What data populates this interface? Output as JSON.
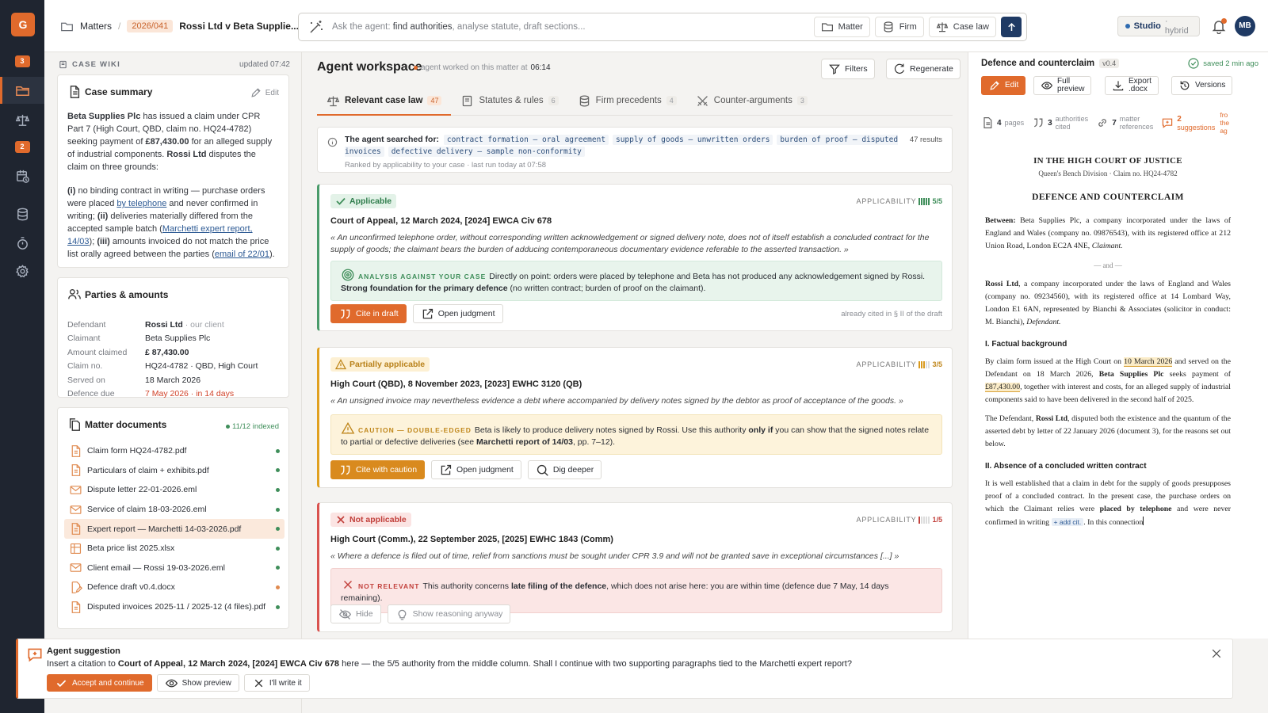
{
  "app": {
    "logo": "G",
    "avatar": "MB"
  },
  "rail": {
    "items": [
      {
        "name": "rail-inbox",
        "icon": "inbox-icon",
        "badge": "3"
      },
      {
        "name": "rail-matters",
        "icon": "folder-icon",
        "active": true
      },
      {
        "name": "rail-caselaw",
        "icon": "scales-icon"
      },
      {
        "name": "rail-tasks",
        "icon": "tasks-icon",
        "badge": "2"
      },
      {
        "name": "rail-calendar",
        "icon": "calendar-icon"
      },
      {
        "name": "rail-database",
        "icon": "database-icon"
      },
      {
        "name": "rail-timer",
        "icon": "timer-icon"
      },
      {
        "name": "rail-settings",
        "icon": "gear-icon"
      }
    ]
  },
  "breadcrumb": {
    "root": "Matters",
    "code": "2026/041",
    "title": "Rossi Ltd v Beta Supplie..."
  },
  "agent_bar": {
    "prefix": "Ask the agent: ",
    "highlight": "find authorities",
    "suffix": ", analyse statute, draft sections...",
    "scopes": [
      "Matter",
      "Firm",
      "Case law"
    ]
  },
  "studio": {
    "label": "Studio",
    "mode": "· hybrid"
  },
  "wiki": {
    "header": "CASE WIKI",
    "updated": "updated 07:42",
    "summary": {
      "title": "Case summary",
      "edit": "Edit",
      "p1": {
        "a": "Beta Supplies Plc",
        "b": " has issued a claim under CPR Part 7 (High Court, QBD, claim no. HQ24-4782) seeking payment of ",
        "c": "£87,430.00",
        "d": " for an alleged supply of industrial components. ",
        "e": "Rossi Ltd",
        "f": " disputes the claim on three grounds:"
      },
      "p2": {
        "a": "(i)",
        "b": " no binding contract in writing — purchase orders were placed ",
        "c": "by telephone",
        "d": " and never confirmed in writing; ",
        "e": "(ii)",
        "f": " deliveries materially differed from the accepted sample batch (",
        "g": "Marchetti expert report, 14/03",
        "h": "); ",
        "i": "(iii)",
        "j": " amounts invoiced do not match the price list orally agreed between the parties (",
        "k": "email of 22/01",
        "l": ")."
      }
    },
    "parties": {
      "title": "Parties & amounts",
      "rows": [
        {
          "k": "Defendant",
          "v": "Rossi Ltd",
          "sub": "· our client",
          "style": "b"
        },
        {
          "k": "Claimant",
          "v": "Beta Supplies Plc",
          "style": ""
        },
        {
          "k": "Amount claimed",
          "v": "£ 87,430.00",
          "style": "b"
        },
        {
          "k": "Claim no.",
          "v": "HQ24-4782 · QBD, High Court",
          "style": ""
        },
        {
          "k": "Served on",
          "v": "18 March 2026",
          "style": ""
        },
        {
          "k": "Defence due",
          "v": "7 May 2026 · in 14 days",
          "style": "red"
        }
      ]
    },
    "documents": {
      "title": "Matter documents",
      "indexed": "11/12 indexed",
      "items": [
        {
          "name": "Claim form HQ24-4782.pdf",
          "icon": "pdf-icon",
          "status": "ok"
        },
        {
          "name": "Particulars of claim + exhibits.pdf",
          "icon": "pdf-icon",
          "status": "ok"
        },
        {
          "name": "Dispute letter 22-01-2026.eml",
          "icon": "mail-icon",
          "status": "ok"
        },
        {
          "name": "Service of claim 18-03-2026.eml",
          "icon": "mail-icon",
          "status": "ok"
        },
        {
          "name": "Expert report — Marchetti 14-03-2026.pdf",
          "icon": "pdf-icon",
          "status": "ok",
          "selected": true
        },
        {
          "name": "Beta price list 2025.xlsx",
          "icon": "spreadsheet-icon",
          "status": "ok"
        },
        {
          "name": "Client email — Rossi 19-03-2026.eml",
          "icon": "mail-icon",
          "status": "ok"
        },
        {
          "name": "Defence draft v0.4.docx",
          "icon": "draft-icon",
          "status": "pending"
        },
        {
          "name": "Disputed invoices 2025-11 / 2025-12 (4 files).pdf",
          "icon": "pdf-icon",
          "status": "ok"
        }
      ]
    }
  },
  "workspace": {
    "title": "Agent workspace",
    "meta": "agent worked on this matter at",
    "meta_time": "06:14",
    "filters": "Filters",
    "regenerate": "Regenerate",
    "tabs": [
      {
        "label": "Relevant case law",
        "count": "47",
        "icon": "scales-icon",
        "active": true
      },
      {
        "label": "Statutes & rules",
        "count": "6",
        "icon": "book-icon"
      },
      {
        "label": "Firm precedents",
        "count": "4",
        "icon": "database-icon"
      },
      {
        "label": "Counter-arguments",
        "count": "3",
        "icon": "swords-icon"
      }
    ],
    "search": {
      "lead": "The agent searched for:",
      "queries": [
        "contract formation — oral agreement",
        "supply of goods — unwritten orders",
        "burden of proof — disputed invoices",
        "defective delivery — sample non-conformity"
      ],
      "ranked": "Ranked by applicability to your case · last run today at 07:58",
      "results": "47 results"
    },
    "applicability_label": "APPLICABILITY",
    "cases": [
      {
        "status": "Applicable",
        "tone": "green",
        "score": "5/5",
        "score_value": 5,
        "court": "Court of Appeal, 12 March 2024, [2024] EWCA Civ 678",
        "quote": "« An unconfirmed telephone order, without corresponding written acknowledgement or signed delivery note, does not of itself establish a concluded contract for the supply of goods; the claimant bears the burden of adducing contemporaneous documentary evidence referable to the asserted transaction. »",
        "analysis_label": "ANALYSIS AGAINST YOUR CASE",
        "analysis_a": "Directly on point: orders were placed by telephone and Beta has not produced any acknowledgement signed by Rossi. ",
        "analysis_b": "Strong foundation for the primary defence",
        "analysis_c": " (no written contract; burden of proof on the claimant).",
        "actions": [
          "Cite in draft",
          "Open judgment"
        ],
        "note": "already cited in § II of the draft"
      },
      {
        "status": "Partially applicable",
        "tone": "amber",
        "score": "3/5",
        "score_value": 3,
        "court": "High Court (QBD), 8 November 2023, [2023] EWHC 3120 (QB)",
        "quote": "« An unsigned invoice may nevertheless evidence a debt where accompanied by delivery notes signed by the debtor as proof of acceptance of the goods. »",
        "analysis_label": "CAUTION — DOUBLE-EDGED",
        "analysis_a": "Beta is likely to produce delivery notes signed by Rossi. Use this authority ",
        "analysis_b": "only if",
        "analysis_c": " you can show that the signed notes relate to partial or defective deliveries (see ",
        "analysis_d": "Marchetti report of 14/03",
        "analysis_e": ", pp. 7–12).",
        "actions": [
          "Cite with caution",
          "Open judgment",
          "Dig deeper"
        ]
      },
      {
        "status": "Not applicable",
        "tone": "red",
        "score": "1/5",
        "score_value": 1,
        "court": "High Court (Comm.), 22 September 2025, [2025] EWHC 1843 (Comm)",
        "quote": "« Where a defence is filed out of time, relief from sanctions must be sought under CPR 3.9 and will not be granted save in exceptional circumstances [...] »",
        "analysis_label": "NOT RELEVANT",
        "analysis_a": "This authority concerns ",
        "analysis_b": "late filing of the defence",
        "analysis_c": ", which does not arise here: you are within time (defence due 7 May, 14 days remaining).",
        "actions": [
          "Hide",
          "Show reasoning anyway"
        ]
      }
    ]
  },
  "draft": {
    "title": "Defence and counterclaim",
    "version": "v0.4",
    "saved": "saved 2 min ago",
    "buttons": {
      "edit": "Edit",
      "preview_a": "Full",
      "preview_b": "preview",
      "export_a": "Export",
      "export_b": ".docx",
      "versions": "Versions"
    },
    "stats": [
      {
        "n": "4",
        "label": "pages",
        "icon": "page-icon"
      },
      {
        "n": "3",
        "label_a": "authorities",
        "label_b": "cited",
        "icon": "quote-icon"
      },
      {
        "n": "7",
        "label_a": "matter",
        "label_b": "references",
        "icon": "link-icon"
      },
      {
        "n": "2",
        "label_a": "suggestions",
        "label_b": "",
        "icon": "suggestion-icon",
        "tone": "orange"
      }
    ],
    "stats_tail": [
      "fro",
      "the",
      "ag"
    ],
    "court": "IN THE HIGH COURT OF JUSTICE",
    "division": "Queen's Bench Division · Claim no. HQ24-4782",
    "heading": "DEFENCE AND COUNTERCLAIM",
    "between": {
      "label": "Between:",
      "name": "Beta Supplies Plc",
      "text": ", a company incorporated under the laws of England and Wales (company no. 09876543), with its registered office at 212 Union Road, London EC2A 4NE, ",
      "role": "Claimant."
    },
    "and": "— and —",
    "defendant": {
      "name": "Rossi Ltd",
      "text": ", a company incorporated under the laws of England and Wales (company no. 09234560), with its registered office at 14 Lombard Way, London E1 6AN, represented by Bianchi & Associates (solicitor in conduct: M. Bianchi), ",
      "role": "Defendant."
    },
    "s1": "I. Factual background",
    "p1": {
      "a": "By claim form issued at the High Court on ",
      "b": "10 March 2026",
      "c": " and served on the Defendant on 18 March 2026, ",
      "d": "Beta Supplies Plc",
      "e": " seeks payment of ",
      "f": "£87,430.00",
      "g": ", together with interest and costs, for an alleged supply of industrial components said to have been delivered in the second half of 2025."
    },
    "p2": {
      "a": "The Defendant, ",
      "b": "Rossi Ltd",
      "c": ", disputed both the existence and the quantum of the asserted debt by letter of 22 January 2026 (document 3), for the reasons set out below."
    },
    "s2": "II. Absence of a concluded written contract",
    "p3": {
      "a": "It is well established that a claim in debt for the supply of goods presupposes proof of a concluded contract. In the present case, the purchase orders on which the Claimant relies were ",
      "b": "placed by telephone",
      "c": " and were never confirmed in writing ",
      "d": "+ add cit.",
      "e": ". In this connection"
    }
  },
  "suggestion": {
    "title": "Agent suggestion",
    "a": "Insert a citation to ",
    "b": "Court of Appeal, 12 March 2024, [2024] EWCA Civ 678",
    "c": " here — the 5/5 authority from the middle column. Shall I continue with two supporting paragraphs tied to the Marchetti expert report?",
    "accept": "Accept and continue",
    "preview": "Show preview",
    "self": "I'll write it"
  },
  "colors": {
    "accent": "#e06a2c",
    "navy": "#1f3a64",
    "rail": "#1f2530",
    "green": "#4a9b6a",
    "amber": "#e0a020",
    "red": "#d9534f"
  }
}
